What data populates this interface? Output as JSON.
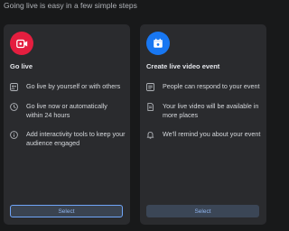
{
  "header": {
    "subtitle": "Going live is easy in a few simple steps"
  },
  "cards": [
    {
      "title": "Go live",
      "badge_icon": "camera-live-icon",
      "badge_color": "#e41e3f",
      "features": [
        {
          "icon": "people-icon",
          "text": "Go live by yourself or with others"
        },
        {
          "icon": "clock-icon",
          "text": "Go live now or automatically within 24 hours"
        },
        {
          "icon": "info-icon",
          "text": "Add interactivity tools to keep your audience engaged"
        }
      ],
      "button": "Select"
    },
    {
      "title": "Create live video event",
      "badge_icon": "calendar-icon",
      "badge_color": "#1877f2",
      "features": [
        {
          "icon": "list-icon",
          "text": "People can respond to your event"
        },
        {
          "icon": "document-icon",
          "text": "Your live video will be available in more places"
        },
        {
          "icon": "bell-icon",
          "text": "We'll remind you about your event"
        }
      ],
      "button": "Select"
    }
  ],
  "colors": {
    "background": "#18191a",
    "card": "#2a2b2e",
    "accent": "#6fa5f8"
  }
}
